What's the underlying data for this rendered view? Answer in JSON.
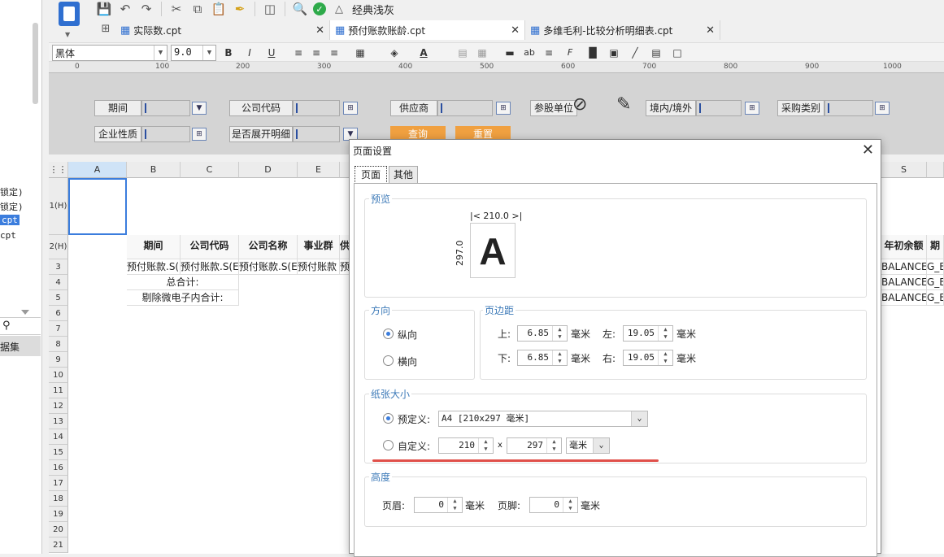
{
  "left_panel": {
    "items": [
      "锁定)",
      "锁定)",
      "cpt",
      "cpt"
    ],
    "dataset_label": "据集"
  },
  "toolbar": {
    "classic_label": "经典浅灰",
    "icons": [
      "save-icon",
      "undo-icon",
      "redo-icon",
      "cut-icon",
      "copy-icon",
      "paste-icon",
      "format-painter-icon",
      "template-icon",
      "preview-icon",
      "check-icon"
    ]
  },
  "tabs": [
    {
      "label": "实际数.cpt"
    },
    {
      "label": "预付账款账龄.cpt"
    },
    {
      "label": "多维毛利-比较分析明细表.cpt"
    }
  ],
  "format_bar": {
    "font": "黑体",
    "size": "9.0"
  },
  "ruler": [
    "0",
    "100",
    "200",
    "300",
    "400",
    "500",
    "600",
    "700",
    "800",
    "900",
    "1000"
  ],
  "params": {
    "labels": [
      "期间",
      "公司代码",
      "供应商",
      "参股单位",
      "境内/境外",
      "采购类别",
      "企业性质",
      "是否展开明细"
    ],
    "query_button": "查询",
    "reset_button": "重置"
  },
  "grid": {
    "columns": [
      "A",
      "B",
      "C",
      "D",
      "E",
      "S"
    ],
    "rows": [
      "1(H)",
      "2(H)",
      "3",
      "4",
      "5",
      "6",
      "7",
      "8",
      "9",
      "10",
      "11",
      "12",
      "13",
      "14",
      "15",
      "16",
      "17",
      "18",
      "19",
      "20",
      "21"
    ],
    "header_row": [
      "期间",
      "公司代码",
      "公司名称",
      "事业群",
      "供"
    ],
    "row3": [
      "预付账款.S(I",
      "预付账款.S(E",
      "预付账款.S(E",
      "预付账款",
      "预"
    ],
    "row4_label": "总合计:",
    "row5_label": "剔除微电子内合计:",
    "right_header": "年初余额",
    "right_header2": "期",
    "right_vals": [
      "BALANCE)",
      "BALANCE)",
      "BALANCE)"
    ],
    "right_vals2": [
      "G_B",
      "G_B",
      "G_B"
    ]
  },
  "dialog": {
    "title": "页面设置",
    "tabs": [
      "页面",
      "其他"
    ],
    "preview": {
      "title": "预览",
      "width_label": "210.0",
      "height_label": "297.0",
      "glyph": "A"
    },
    "orientation": {
      "title": "方向",
      "portrait": "纵向",
      "landscape": "横向",
      "selected": "portrait"
    },
    "margins": {
      "title": "页边距",
      "top_label": "上:",
      "top": "6.85",
      "bottom_label": "下:",
      "bottom": "6.85",
      "left_label": "左:",
      "left": "19.05",
      "right_label": "右:",
      "right": "19.05",
      "unit": "毫米"
    },
    "paper": {
      "title": "纸张大小",
      "predefined_label": "预定义:",
      "predefined_value": "A4 [210x297 毫米]",
      "custom_label": "自定义:",
      "custom_width": "210",
      "custom_height": "297",
      "times": "x",
      "custom_unit": "毫米",
      "selected": "predefined"
    },
    "height": {
      "title": "高度",
      "header_label": "页眉:",
      "header": "0",
      "footer_label": "页脚:",
      "footer": "0",
      "unit": "毫米"
    }
  },
  "colors": {
    "accent": "#3b7ddd",
    "group_title": "#3d7ab8",
    "highlight_line": "#e0504a",
    "param_button": "#f0a040"
  }
}
